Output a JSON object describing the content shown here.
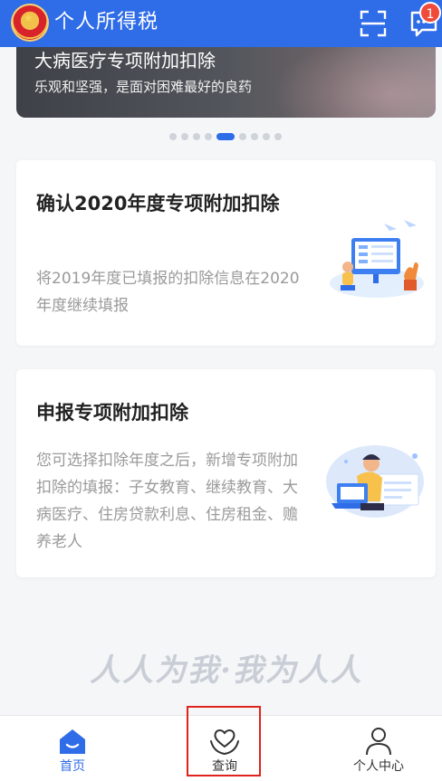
{
  "header": {
    "title": "个人所得税",
    "message_badge": "1",
    "scan_icon": "scan-icon",
    "message_icon": "message-icon",
    "background": "#2f6ce8"
  },
  "banner": {
    "title": "大病医疗专项附加扣除",
    "subtitle": "乐观和坚强，是面对困难最好的良药",
    "page_count": 9,
    "active_index": 4
  },
  "cards": [
    {
      "title": "确认2020年度专项附加扣除",
      "description": "将2019年度已填报的扣除信息在2020年度继续填报",
      "illustration": "computer-illustration"
    },
    {
      "title": "申报专项附加扣除",
      "description": "您可选择扣除年度之后，新增专项附加扣除的填报：子女教育、继续教育、大病医疗、住房贷款利息、住房租金、赡养老人",
      "illustration": "person-laptop-illustration"
    }
  ],
  "slogan": "人人为我·我为人人",
  "bottom_nav": {
    "items": [
      {
        "label": "首页",
        "icon": "home-icon",
        "active": true
      },
      {
        "label": "查询",
        "icon": "heart-hands-icon",
        "active": false
      },
      {
        "label": "个人中心",
        "icon": "person-icon",
        "active": false
      }
    ]
  },
  "colors": {
    "accent": "#2f6ce8",
    "badge": "#f04b3a",
    "highlight": "#e0231c"
  }
}
